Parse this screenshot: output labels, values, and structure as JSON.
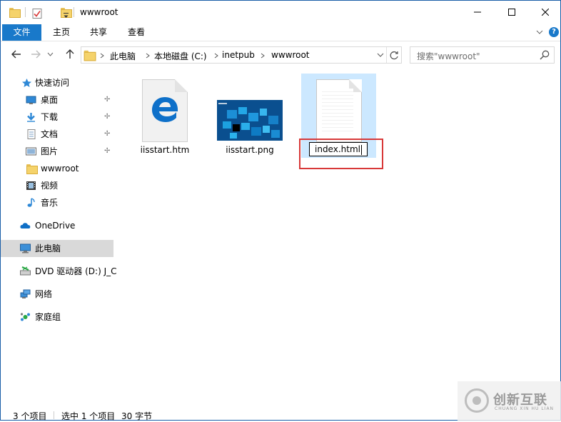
{
  "window": {
    "title": "wwwroot"
  },
  "ribbon": {
    "tabs": [
      "文件",
      "主页",
      "共享",
      "查看"
    ],
    "help": "?"
  },
  "address": {
    "crumbs": [
      "此电脑",
      "本地磁盘 (C:)",
      "inetpub",
      "wwwroot"
    ]
  },
  "search": {
    "placeholder": "搜索\"wwwroot\""
  },
  "sidebar": {
    "items": [
      {
        "label": "快速访问",
        "icon": "star-icon"
      },
      {
        "label": "桌面",
        "icon": "desktop-icon",
        "pinned": true
      },
      {
        "label": "下载",
        "icon": "download-icon",
        "pinned": true
      },
      {
        "label": "文档",
        "icon": "document-icon",
        "pinned": true
      },
      {
        "label": "图片",
        "icon": "pictures-icon",
        "pinned": true
      },
      {
        "label": "wwwroot",
        "icon": "folder-icon"
      },
      {
        "label": "视频",
        "icon": "video-icon"
      },
      {
        "label": "音乐",
        "icon": "music-icon"
      },
      {
        "label": "OneDrive",
        "icon": "cloud-icon"
      },
      {
        "label": "此电脑",
        "icon": "computer-icon",
        "selected": true
      },
      {
        "label": "DVD 驱动器 (D:) J_C",
        "icon": "dvd-icon"
      },
      {
        "label": "网络",
        "icon": "network-icon"
      },
      {
        "label": "家庭组",
        "icon": "homegroup-icon"
      }
    ]
  },
  "files": [
    {
      "name": "iisstart.htm",
      "icon": "edge-html-icon"
    },
    {
      "name": "iisstart.png",
      "icon": "image-thumbnail"
    },
    {
      "name": "index.html",
      "icon": "blank-document-icon",
      "renaming": true
    }
  ],
  "status": {
    "count": "3 个项目",
    "selected": "选中 1 个项目",
    "size": "30 字节"
  },
  "watermark": {
    "text": "创新互联",
    "sub": "CHUANG XIN HU LIAN"
  },
  "colors": {
    "accent": "#1979ca",
    "selection": "#cce8ff",
    "highlight": "#d83838"
  }
}
